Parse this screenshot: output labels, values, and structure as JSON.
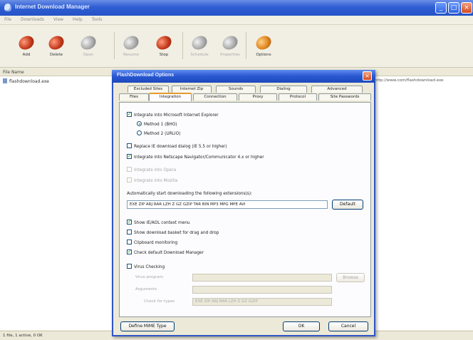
{
  "app": {
    "title": "Internet Download Manager",
    "menu": [
      "File",
      "Downloads",
      "View",
      "Help",
      "Tools"
    ],
    "window_buttons": {
      "minimize": "_",
      "maximize": "□",
      "close": "×"
    }
  },
  "toolbar": {
    "items": [
      {
        "label": "Add",
        "icon": "add-egg-icon",
        "color": "red",
        "enabled": true
      },
      {
        "label": "Delete",
        "icon": "delete-egg-icon",
        "color": "red",
        "enabled": true
      },
      {
        "label": "Open",
        "icon": "open-egg-icon",
        "color": "gray",
        "enabled": false
      },
      {
        "label": "Resume",
        "icon": "resume-egg-icon",
        "color": "gray",
        "enabled": false
      },
      {
        "label": "Stop",
        "icon": "stop-egg-icon",
        "color": "red",
        "enabled": true
      },
      {
        "label": "Schedule",
        "icon": "schedule-egg-icon",
        "color": "gray",
        "enabled": false
      },
      {
        "label": "Properties",
        "icon": "properties-egg-icon",
        "color": "gray",
        "enabled": false
      },
      {
        "label": "Options",
        "icon": "options-egg-icon",
        "color": "orange",
        "enabled": true
      }
    ]
  },
  "list": {
    "column_header": "File Name",
    "rows": [
      {
        "name": "flashdownload.exe"
      }
    ],
    "right_path": "http://www.com/flashdownload.exe"
  },
  "status": {
    "text": "1 file, 1 active, 0 OK"
  },
  "dialog": {
    "title": "FlashDownload Options",
    "tabs_row1": [
      "Excluded Sites",
      "Internet Zip",
      "Sounds",
      "Dialing",
      "Advanced"
    ],
    "tabs_row2": [
      "Files",
      "Integration",
      "Connection",
      "Proxy",
      "Protocol",
      "Site Passwords"
    ],
    "active_tab": "Integration",
    "options": [
      {
        "label": "Integrate into Microsoft Internet Explorer",
        "checked": true,
        "type": "checkbox",
        "enabled": true
      },
      {
        "label": "Method 1 (BHO)",
        "type": "radio",
        "selected": true
      },
      {
        "label": "Method 2 (URLIO)",
        "type": "radio",
        "selected": false
      },
      {
        "label": "Replace IE download dialog (IE 5.5 or higher)",
        "checked": false,
        "type": "checkbox",
        "enabled": true
      },
      {
        "label": "Integrate into Netscape Navigator/Communicator 4.x or higher",
        "checked": true,
        "type": "checkbox",
        "enabled": true
      },
      {
        "label": "Integrate into Opera",
        "checked": false,
        "type": "checkbox",
        "enabled": false
      },
      {
        "label": "Integrate into Mozilla",
        "checked": false,
        "type": "checkbox",
        "enabled": false
      }
    ],
    "extensions_label": "Automatically start downloading the following extensions(s):",
    "extensions_value": "EXE ZIP ARJ RAR LZH Z GZ GZIP TAR BIN MP3 MPG MPE AVI",
    "default_button": "Default",
    "options2": [
      {
        "label": "Show IE/AOL context menu",
        "checked": true,
        "enabled": true
      },
      {
        "label": "Show download basket for drag and drop",
        "checked": false,
        "enabled": true
      },
      {
        "label": "Clipboard monitoring",
        "checked": false,
        "enabled": true
      },
      {
        "label": "Check default Download Manager",
        "checked": true,
        "enabled": true
      }
    ],
    "group": {
      "title": "Virus Checking",
      "checked": false,
      "fields": [
        "Virus program",
        "Arguments",
        "Check for types"
      ],
      "field_values": [
        "",
        "",
        "EXE ZIP ARJ RAR LZH Z GZ GZIP"
      ],
      "browse_label": "Browse"
    },
    "footer": {
      "mime_button": "Define MIME Type",
      "ok_button": "OK",
      "cancel_button": "Cancel"
    }
  }
}
